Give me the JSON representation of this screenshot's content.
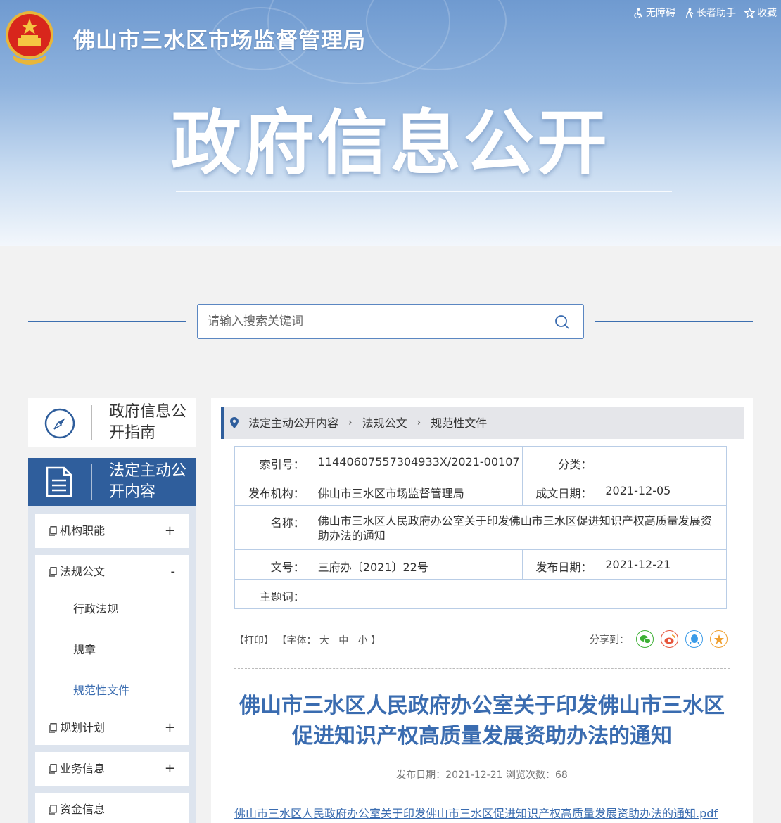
{
  "header": {
    "site_title": "佛山市三水区市场监督管理局",
    "hero_title": "政府信息公开",
    "top_links": [
      {
        "label": "无障碍",
        "icon": "accessibility-icon"
      },
      {
        "label": "长者助手",
        "icon": "elder-helper-icon"
      },
      {
        "label": "收藏",
        "icon": "star-icon"
      }
    ]
  },
  "search": {
    "placeholder": "请输入搜索关键词"
  },
  "sidebar": {
    "guide_label": "政府信息公开指南",
    "active_label": "法定主动公开内容",
    "menu": [
      {
        "label": "机构职能",
        "toggle": "+"
      },
      {
        "label": "法规公文",
        "toggle": "-",
        "children": [
          "行政法规",
          "规章",
          "规范性文件"
        ]
      },
      {
        "label": "规划计划",
        "toggle": "+"
      },
      {
        "label": "业务信息",
        "toggle": "+"
      },
      {
        "label": "资金信息",
        "toggle": ""
      }
    ]
  },
  "breadcrumb": [
    "法定主动公开内容",
    "法规公文",
    "规范性文件"
  ],
  "meta": {
    "index_label": "索引号：",
    "index_value": "11440607557304933X/2021-00107",
    "category_label": "分类：",
    "category_value": "",
    "publisher_label": "发布机构：",
    "publisher_value": "佛山市三水区市场监督管理局",
    "created_label": "成文日期：",
    "created_value": "2021-12-05",
    "name_label": "名称：",
    "name_value": "佛山市三水区人民政府办公室关于印发佛山市三水区促进知识产权高质量发展资助办法的通知",
    "docno_label": "文号：",
    "docno_value": "三府办〔2021〕22号",
    "pubdate_label": "发布日期：",
    "pubdate_value": "2021-12-21",
    "subject_label": "主题词：",
    "subject_value": ""
  },
  "tools": {
    "print": "【打印】",
    "font_prefix": "【字体：",
    "font_large": "大",
    "font_mid": "中",
    "font_small": "小",
    "font_suffix": "】",
    "share_label": "分享到："
  },
  "article": {
    "title": "佛山市三水区人民政府办公室关于印发佛山市三水区促进知识产权高质量发展资助办法的通知",
    "publish_info": "发布日期：2021-12-21  浏览次数：68",
    "attachment": "佛山市三水区人民政府办公室关于印发佛山市三水区促进知识产权高质量发展资助办法的通知.pdf"
  },
  "colors": {
    "primary": "#2f5e9c",
    "link": "#3a6cb0",
    "banner_top": "#6f9ad0"
  }
}
